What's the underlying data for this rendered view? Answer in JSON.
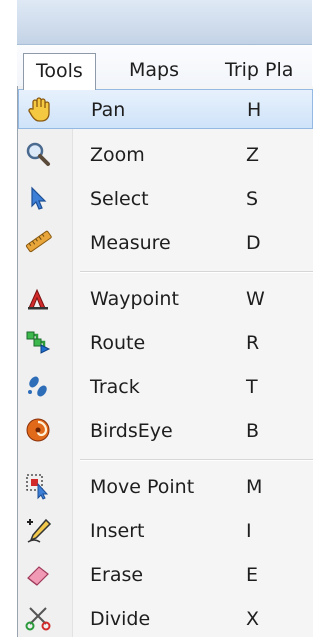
{
  "menubar": {
    "tabs": [
      {
        "label": "Tools",
        "active": true
      },
      {
        "label": "Maps",
        "active": false
      },
      {
        "label": "Trip Pla",
        "active": false
      }
    ]
  },
  "tools_menu": {
    "items": [
      {
        "label": "Pan",
        "shortcut": "H",
        "icon": "hand-icon",
        "highlighted": true
      },
      {
        "label": "Zoom",
        "shortcut": "Z",
        "icon": "magnifier-icon"
      },
      {
        "label": "Select",
        "shortcut": "S",
        "icon": "arrow-cursor-icon"
      },
      {
        "label": "Measure",
        "shortcut": "D",
        "icon": "ruler-icon"
      },
      {
        "label": "Waypoint",
        "shortcut": "W",
        "icon": "waypoint-flag-icon"
      },
      {
        "label": "Route",
        "shortcut": "R",
        "icon": "route-icon"
      },
      {
        "label": "Track",
        "shortcut": "T",
        "icon": "footprints-icon"
      },
      {
        "label": "BirdsEye",
        "shortcut": "B",
        "icon": "birdseye-icon"
      },
      {
        "label": "Move Point",
        "shortcut": "M",
        "icon": "move-point-icon"
      },
      {
        "label": "Insert",
        "shortcut": "I",
        "icon": "insert-pencil-icon"
      },
      {
        "label": "Erase",
        "shortcut": "E",
        "icon": "eraser-icon"
      },
      {
        "label": "Divide",
        "shortcut": "X",
        "icon": "scissors-icon"
      }
    ]
  },
  "colors": {
    "highlight": "#cfe3f9",
    "highlight_border": "#94b9e3",
    "menu_background": "#f5f5f5"
  }
}
